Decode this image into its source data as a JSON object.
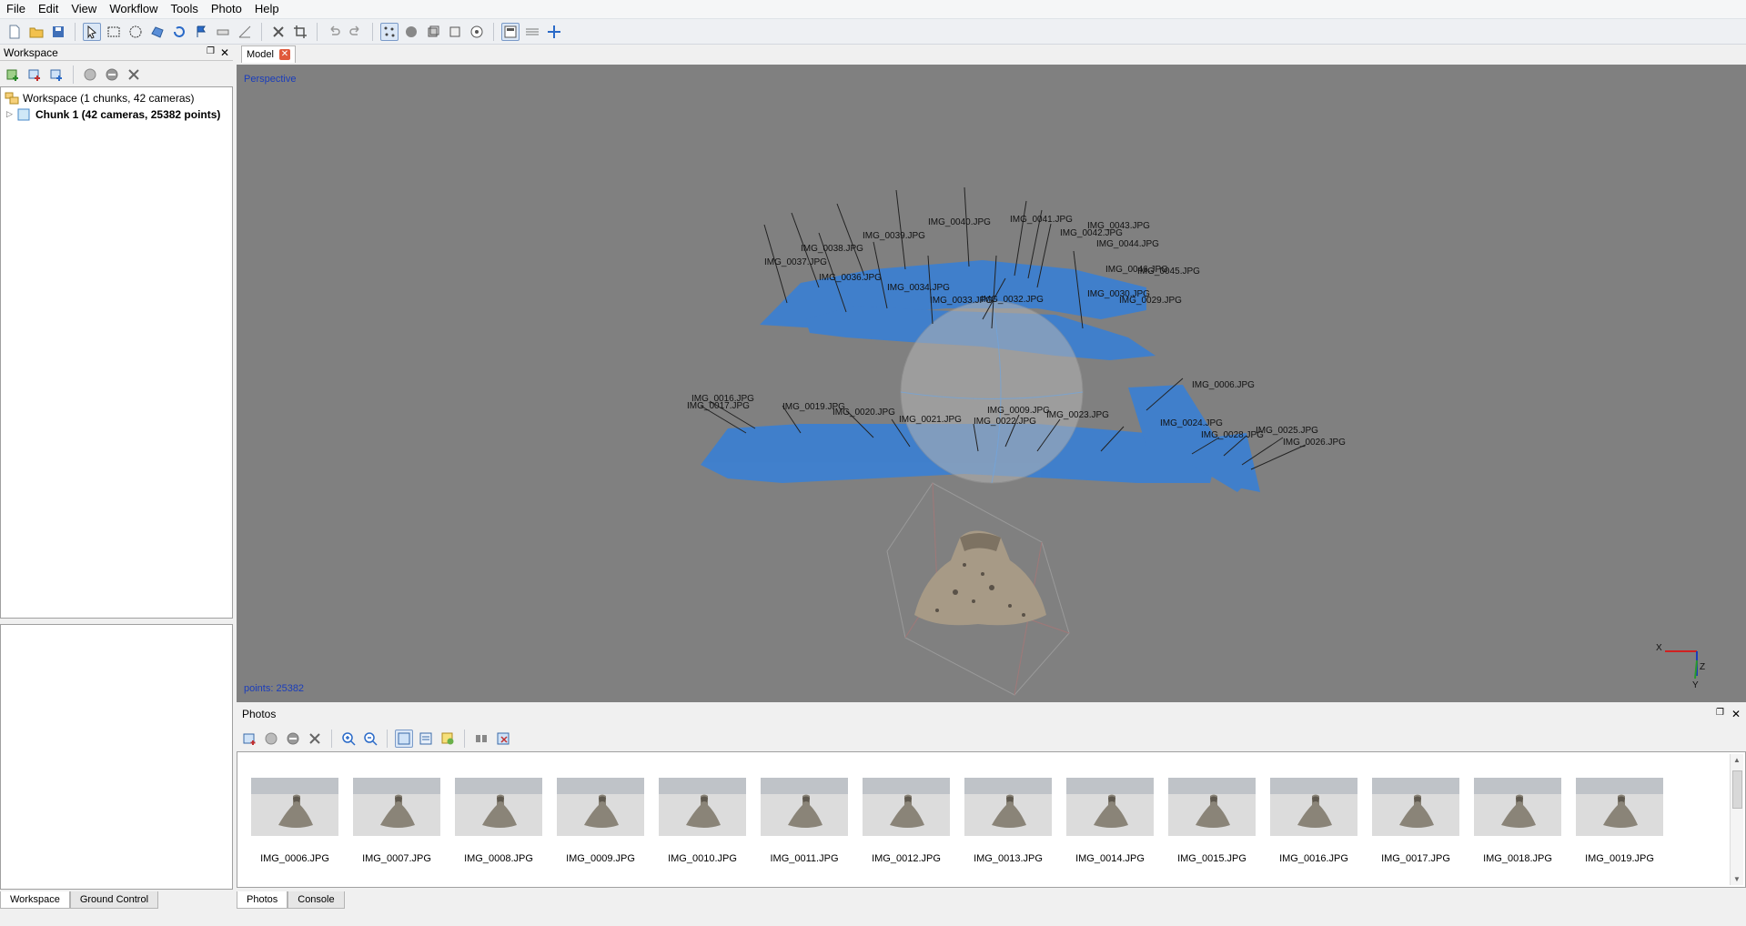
{
  "menu": [
    "File",
    "Edit",
    "View",
    "Workflow",
    "Tools",
    "Photo",
    "Help"
  ],
  "toolbar": {
    "icons": [
      "new-icon",
      "open-icon",
      "save-icon",
      "navigation-icon",
      "rectangle-selection-icon",
      "circle-selection-icon",
      "free-form-selection-icon",
      "rotate-icon",
      "flag-marker-icon",
      "ruler-icon",
      "measure-icon",
      "delete-icon",
      "crop-icon",
      "undo-icon",
      "redo-icon",
      "show-points-icon",
      "show-sphere-icon",
      "show-cameras-icon",
      "show-region-icon",
      "reset-view-icon",
      "show-info-icon",
      "grid-icon",
      "move-object-icon"
    ]
  },
  "workspace": {
    "title": "Workspace",
    "root_label": "Workspace (1 chunks, 42 cameras)",
    "chunk_label": "Chunk 1 (42 cameras, 25382 points)",
    "tabs": [
      "Workspace",
      "Ground Control"
    ],
    "active_tab": "Workspace"
  },
  "model": {
    "tab_label": "Model",
    "view_label": "Perspective",
    "points_label": "points: 25382",
    "axis": {
      "x": "X",
      "z": "Z",
      "y": "Y"
    },
    "camera_labels": [
      "IMG_0040.JPG",
      "IMG_0041.JPG",
      "IMG_0039.JPG",
      "IMG_0043.JPG",
      "IMG_0042.JPG",
      "IMG_0038.JPG",
      "IMG_0044.JPG",
      "IMG_0037.JPG",
      "IMG_0036.JPG",
      "IMG_0046.JPG",
      "IMG_0045.JPG",
      "IMG_0034.JPG",
      "IMG_0030.JPG",
      "IMG_0033.JPG",
      "IMG_0032.JPG",
      "IMG_0029.JPG",
      "IMG_0006.JPG",
      "IMG_0019.JPG",
      "IMG_0020.JPG",
      "IMG_0021.JPG",
      "IMG_0009.JPG",
      "IMG_0023.JPG",
      "IMG_0022.JPG",
      "IMG_0024.JPG",
      "IMG_0028.JPG",
      "IMG_0025.JPG",
      "IMG_0026.JPG",
      "IMG_0016.JPG",
      "IMG_0017.JPG"
    ]
  },
  "photos": {
    "title": "Photos",
    "captions": [
      "IMG_0006.JPG",
      "IMG_0007.JPG",
      "IMG_0008.JPG",
      "IMG_0009.JPG",
      "IMG_0010.JPG",
      "IMG_0011.JPG",
      "IMG_0012.JPG",
      "IMG_0013.JPG",
      "IMG_0014.JPG",
      "IMG_0015.JPG",
      "IMG_0016.JPG",
      "IMG_0017.JPG",
      "IMG_0018.JPG",
      "IMG_0019.JPG"
    ],
    "tabs": [
      "Photos",
      "Console"
    ],
    "active_tab": "Photos"
  },
  "colors": {
    "viewport_bg": "#808080",
    "camera_plane": "#3d7fd0",
    "overlay_text": "#1a3dbb"
  }
}
